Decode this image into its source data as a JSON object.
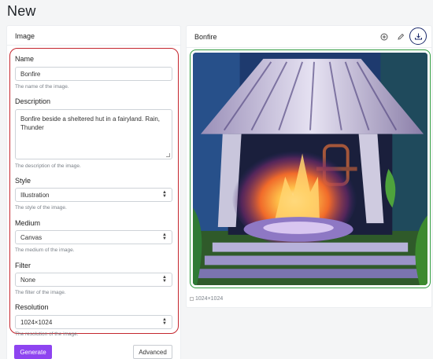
{
  "page": {
    "title": "New"
  },
  "form": {
    "header": "Image",
    "name": {
      "label": "Name",
      "value": "Bonfire",
      "help": "The name of the image."
    },
    "description": {
      "label": "Description",
      "value": "Bonfire beside a sheltered hut in a fairyland. Rain, Thunder",
      "help": "The description of the image."
    },
    "style": {
      "label": "Style",
      "value": "Illustration",
      "help": "The style of the image."
    },
    "medium": {
      "label": "Medium",
      "value": "Canvas",
      "help": "The medium of the image."
    },
    "filter": {
      "label": "Filter",
      "value": "None",
      "help": "The filter of the image."
    },
    "resolution": {
      "label": "Resolution",
      "value": "1024×1024",
      "help": "The resolution of the image."
    },
    "generate_label": "Generate",
    "advanced_label": "Advanced"
  },
  "preview": {
    "title": "Bonfire",
    "resolution_caption": "1024×1024",
    "icons": [
      "add-circle-icon",
      "pencil-icon",
      "download-icon"
    ]
  },
  "colors": {
    "accent_purple": "#8e44f0",
    "form_outline_red": "#c4262e",
    "image_outline_green": "#2e9a3e",
    "download_ring_navy": "#1b2a6b"
  }
}
